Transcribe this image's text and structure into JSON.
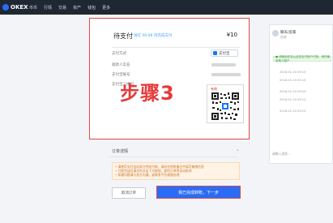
{
  "brand": {
    "name": "OKEX"
  },
  "nav": [
    "币币",
    "行情",
    "交易",
    "资产",
    "钱包",
    "更多"
  ],
  "payment": {
    "title": "待支付",
    "subtitle": "请在 00:08 内完成支付",
    "amount": "¥10",
    "method_label": "支付方式",
    "payee_label": "收款人实名",
    "account_label": "支付宝账号",
    "qr_label": "支付宝二维码",
    "method_value": "支付宝"
  },
  "qr": {
    "small_text": "有效"
  },
  "watermark": "步骤3",
  "order": {
    "label": "订单详情"
  },
  "notice": {
    "lines": [
      "• 请使用支付宝向卖方完成付款，请勿在转账备注中填写敏感信息",
      "• 付款完成后请及时点击下方按钮，超时订单将自动取消",
      "• 如遇问题请与卖方沟通，或联系平台客服处理"
    ]
  },
  "buttons": {
    "cancel": "取消订单",
    "confirm": "我已完成转账，下一步"
  },
  "chat": {
    "name": "聊天/卖家",
    "sub": "在线",
    "banner": "● 请使用实名认证的支付账户付款，请勿使用他人账户",
    "lines": [
      "2018-01-10 09:10",
      "2018-01-10 09:10",
      "2018-01-10 09:10",
      "2018-01-10 09:10",
      "2018-01-10 09:10"
    ],
    "input": "请输入消息..."
  }
}
